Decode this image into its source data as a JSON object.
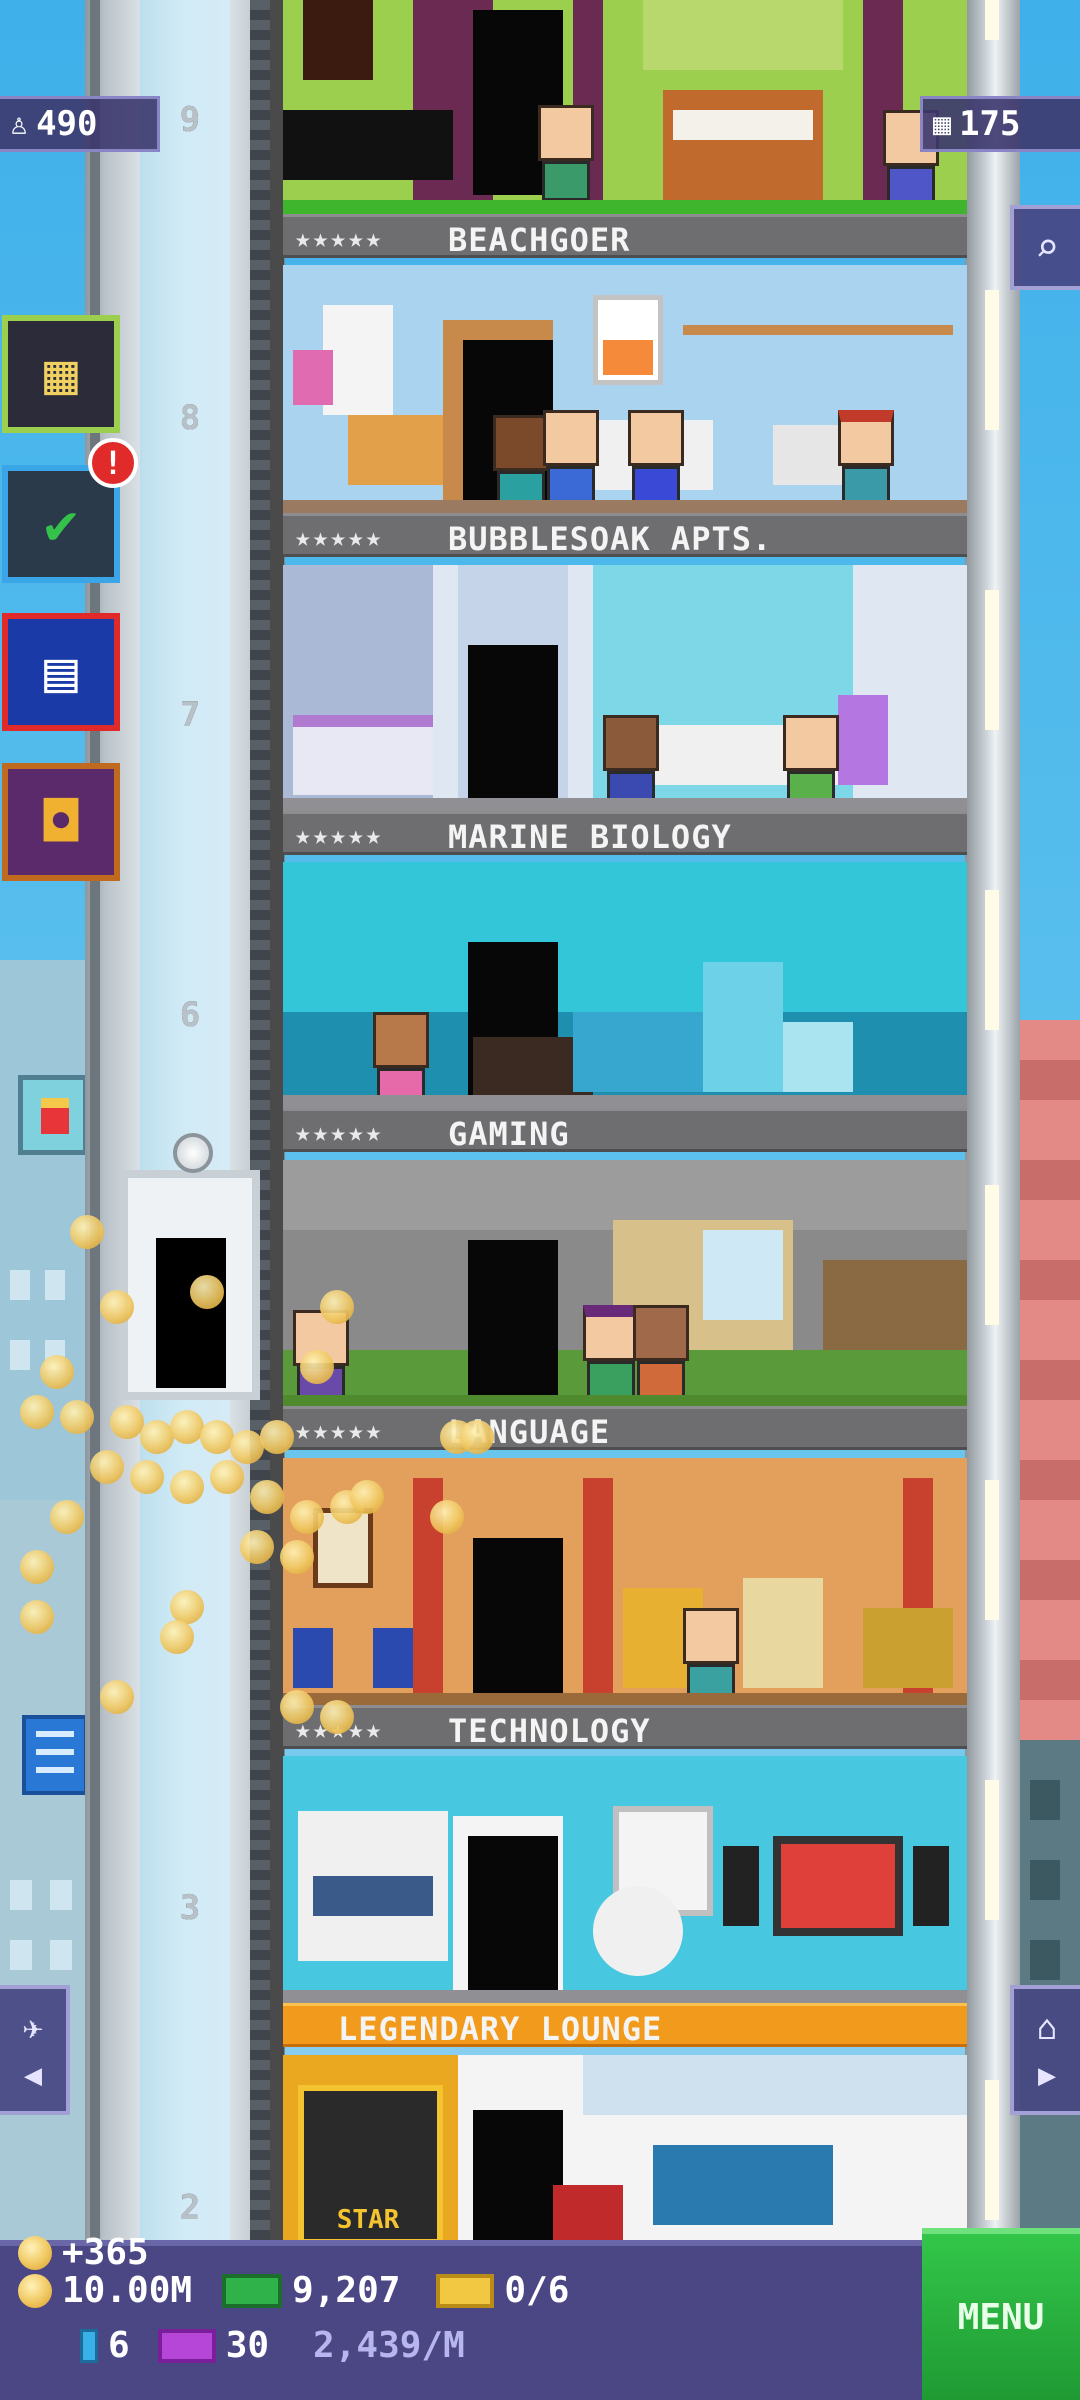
{
  "hud": {
    "population": "490",
    "floors": "175"
  },
  "elevator": {
    "floor_numbers": [
      "9",
      "8",
      "7",
      "6",
      "3",
      "2"
    ]
  },
  "floors": [
    {
      "stars": "★★★★★",
      "name": "BEACHGOER"
    },
    {
      "stars": "★★★★★",
      "name": "BUBBLESOAK APTS."
    },
    {
      "stars": "★★★★★",
      "name": "MARINE BIOLOGY"
    },
    {
      "stars": "★★★★★",
      "name": "GAMING"
    },
    {
      "stars": "★★★★★",
      "name": "LANGUAGE"
    },
    {
      "stars": "★★★★★",
      "name": "TECHNOLOGY"
    },
    {
      "stars": "",
      "name": "LEGENDARY LOUNGE"
    }
  ],
  "side_buttons": {
    "mission_badge": "!"
  },
  "room_signs": {
    "legend_star_sign": "STAR"
  },
  "bottom_bar": {
    "coin_gain": "+365",
    "coins": "10.00M",
    "bux": "9,207",
    "tickets": "0/6",
    "cards": "6",
    "vip": "30",
    "rate": "2,439/M",
    "menu_label": "MENU"
  },
  "colors": {
    "accent_menu": "#1f9a33",
    "bar_bg": "#4a4784",
    "legend_label": "#f29a1c"
  }
}
